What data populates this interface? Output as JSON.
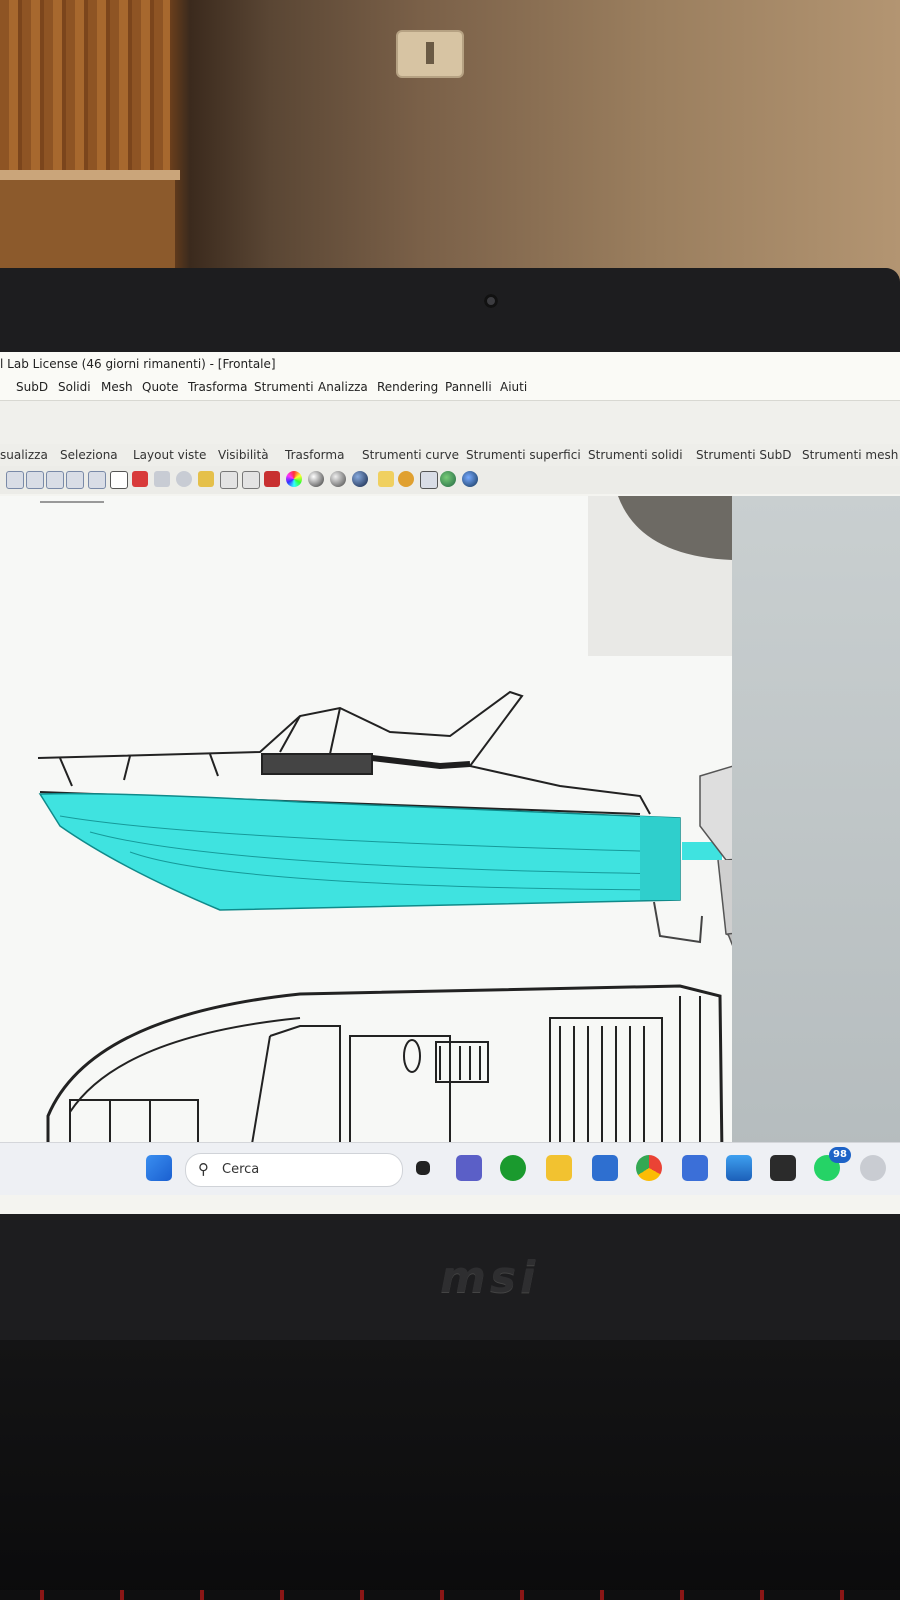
{
  "window": {
    "title": "l Lab License (46 giorni rimanenti) - [Frontale]"
  },
  "menu": [
    "SubD",
    "Solidi",
    "Mesh",
    "Quote",
    "Trasforma",
    "Strumenti",
    "Analizza",
    "Rendering",
    "Pannelli",
    "Aiuti"
  ],
  "toolbar_tabs": [
    "sualizza",
    "Seleziona",
    "Layout viste",
    "Visibilità",
    "Trasforma",
    "Strumenti curve",
    "Strumenti superfici",
    "Strumenti solidi",
    "Strumenti SubD",
    "Strumenti mesh"
  ],
  "icons": [
    "zoom-window-icon",
    "zoom-extents-icon",
    "zoom-selected-icon",
    "zoom-dynamic-icon",
    "undo-view-icon",
    "grid-icon",
    "car-icon",
    "orbit-icon",
    "rotate-icon",
    "properties-icon",
    "light-icon",
    "lock-icon",
    "shade-icon",
    "color-wheel-icon",
    "render-sphere-icon",
    "material-icon",
    "globe-icon",
    "curve-icon",
    "gear-icon",
    "layer-icon",
    "earth-icon",
    "help-icon"
  ],
  "taskbar": {
    "search_placeholder": "Cerca",
    "whatsapp_badge": "98",
    "apps": [
      "start-icon",
      "task-view-icon",
      "teams-icon",
      "xbox-icon",
      "file-explorer-icon",
      "store-icon",
      "chrome-icon",
      "app-icon",
      "photos-icon",
      "rhino-icon",
      "whatsapp-icon",
      "other-icon"
    ]
  },
  "device": {
    "brand": "msi"
  },
  "colors": {
    "hull": "#3fe3e0",
    "hull_dark": "#19b5b4",
    "accent_taskbar": "#1e63c7"
  }
}
